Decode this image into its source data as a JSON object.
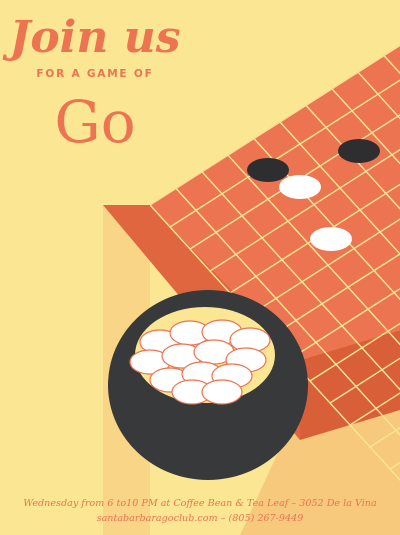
{
  "poster": {
    "headline": "Join us",
    "tagline": "FOR A GAME OF",
    "game_name": "Go",
    "event_details": "Wednesday from 6 to10 PM at Coffee Bean & Tea Leaf – 3052 De la Vina",
    "contact": "santabarbaragoclub.com – (805) 267-9449"
  },
  "colors": {
    "background": "#fbe693",
    "accent": "#ec7451",
    "board_side": "#e86f4f",
    "grid_lines": "#fbe693",
    "bowl": "#38393b",
    "black_stone": "#2e2e30",
    "white_stone": "#ffffff"
  },
  "icons": [
    "go-board-illustration",
    "black-stone-icon",
    "white-stone-icon",
    "stone-bowl-icon"
  ]
}
